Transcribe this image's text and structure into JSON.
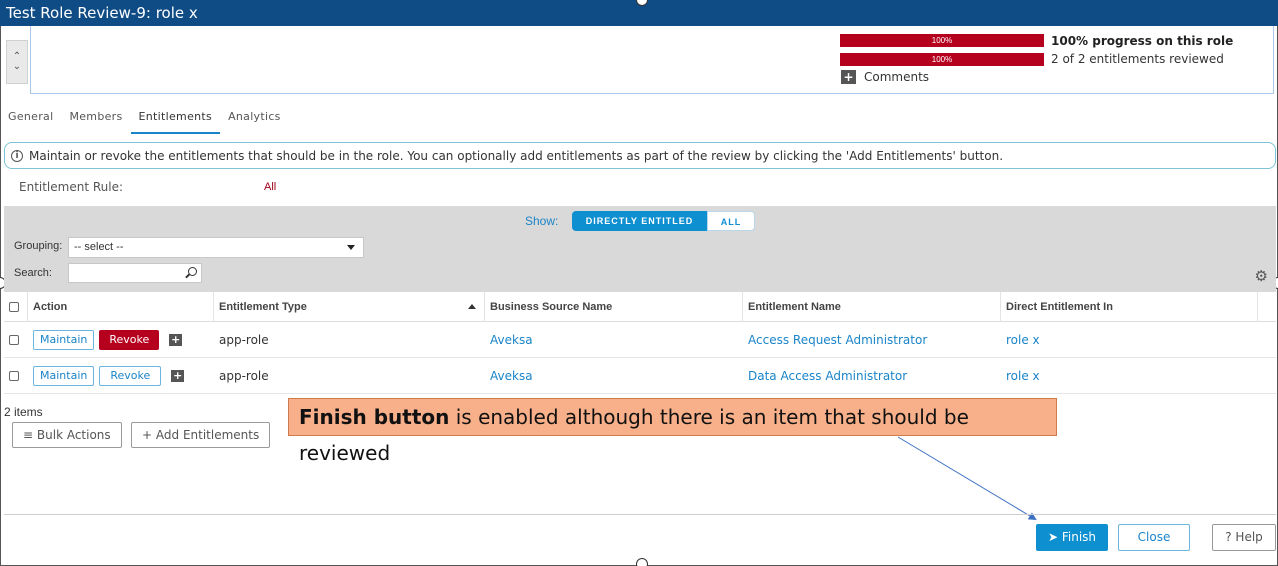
{
  "window": {
    "title": "Test Role Review-9: role x"
  },
  "summary": {
    "progress_bar_1": {
      "label": "100%",
      "value": 100
    },
    "progress_bar_2": {
      "label": "100%",
      "value": 100
    },
    "progress_text": "100% progress on this role",
    "reviewed_text": "2 of 2 entitlements reviewed",
    "comments_label": "Comments"
  },
  "tabs": [
    {
      "label": "General"
    },
    {
      "label": "Members"
    },
    {
      "label": "Entitlements",
      "active": true
    },
    {
      "label": "Analytics"
    }
  ],
  "info_message": "Maintain or revoke the entitlements that should be in the role. You can optionally add entitlements as part of the review by clicking the 'Add Entitlements' button.",
  "entitlement_rule": {
    "label": "Entitlement Rule:",
    "value": "All"
  },
  "filters": {
    "show_label": "Show:",
    "show_options": [
      "DIRECTLY ENTITLED",
      "ALL"
    ],
    "grouping_label": "Grouping:",
    "grouping_value": "-- select --",
    "search_label": "Search:",
    "search_value": ""
  },
  "table": {
    "headers": [
      "Action",
      "Entitlement Type",
      "Business Source Name",
      "Entitlement Name",
      "Direct Entitlement In"
    ],
    "action_labels": {
      "maintain": "Maintain",
      "revoke": "Revoke"
    },
    "rows": [
      {
        "type": "app-role",
        "source": "Aveksa",
        "name": "Access Request Administrator",
        "direct_in": "role x",
        "revoked": true
      },
      {
        "type": "app-role",
        "source": "Aveksa",
        "name": "Data Access Administrator",
        "direct_in": "role x",
        "revoked": false
      }
    ]
  },
  "item_count": "2 items",
  "bottom_buttons": {
    "bulk_actions": "Bulk Actions",
    "add_entitlements": "Add Entitlements"
  },
  "annotation": {
    "bold": "Finish button",
    "rest": " is enabled although there is an item that should be reviewed"
  },
  "footer": {
    "finish": "Finish",
    "close": "Close",
    "help": "Help"
  },
  "colors": {
    "title_bar": "#0f4c86",
    "accent": "#0e8fd0",
    "revoke": "#b5001e",
    "annotation": "#f7b08a"
  }
}
